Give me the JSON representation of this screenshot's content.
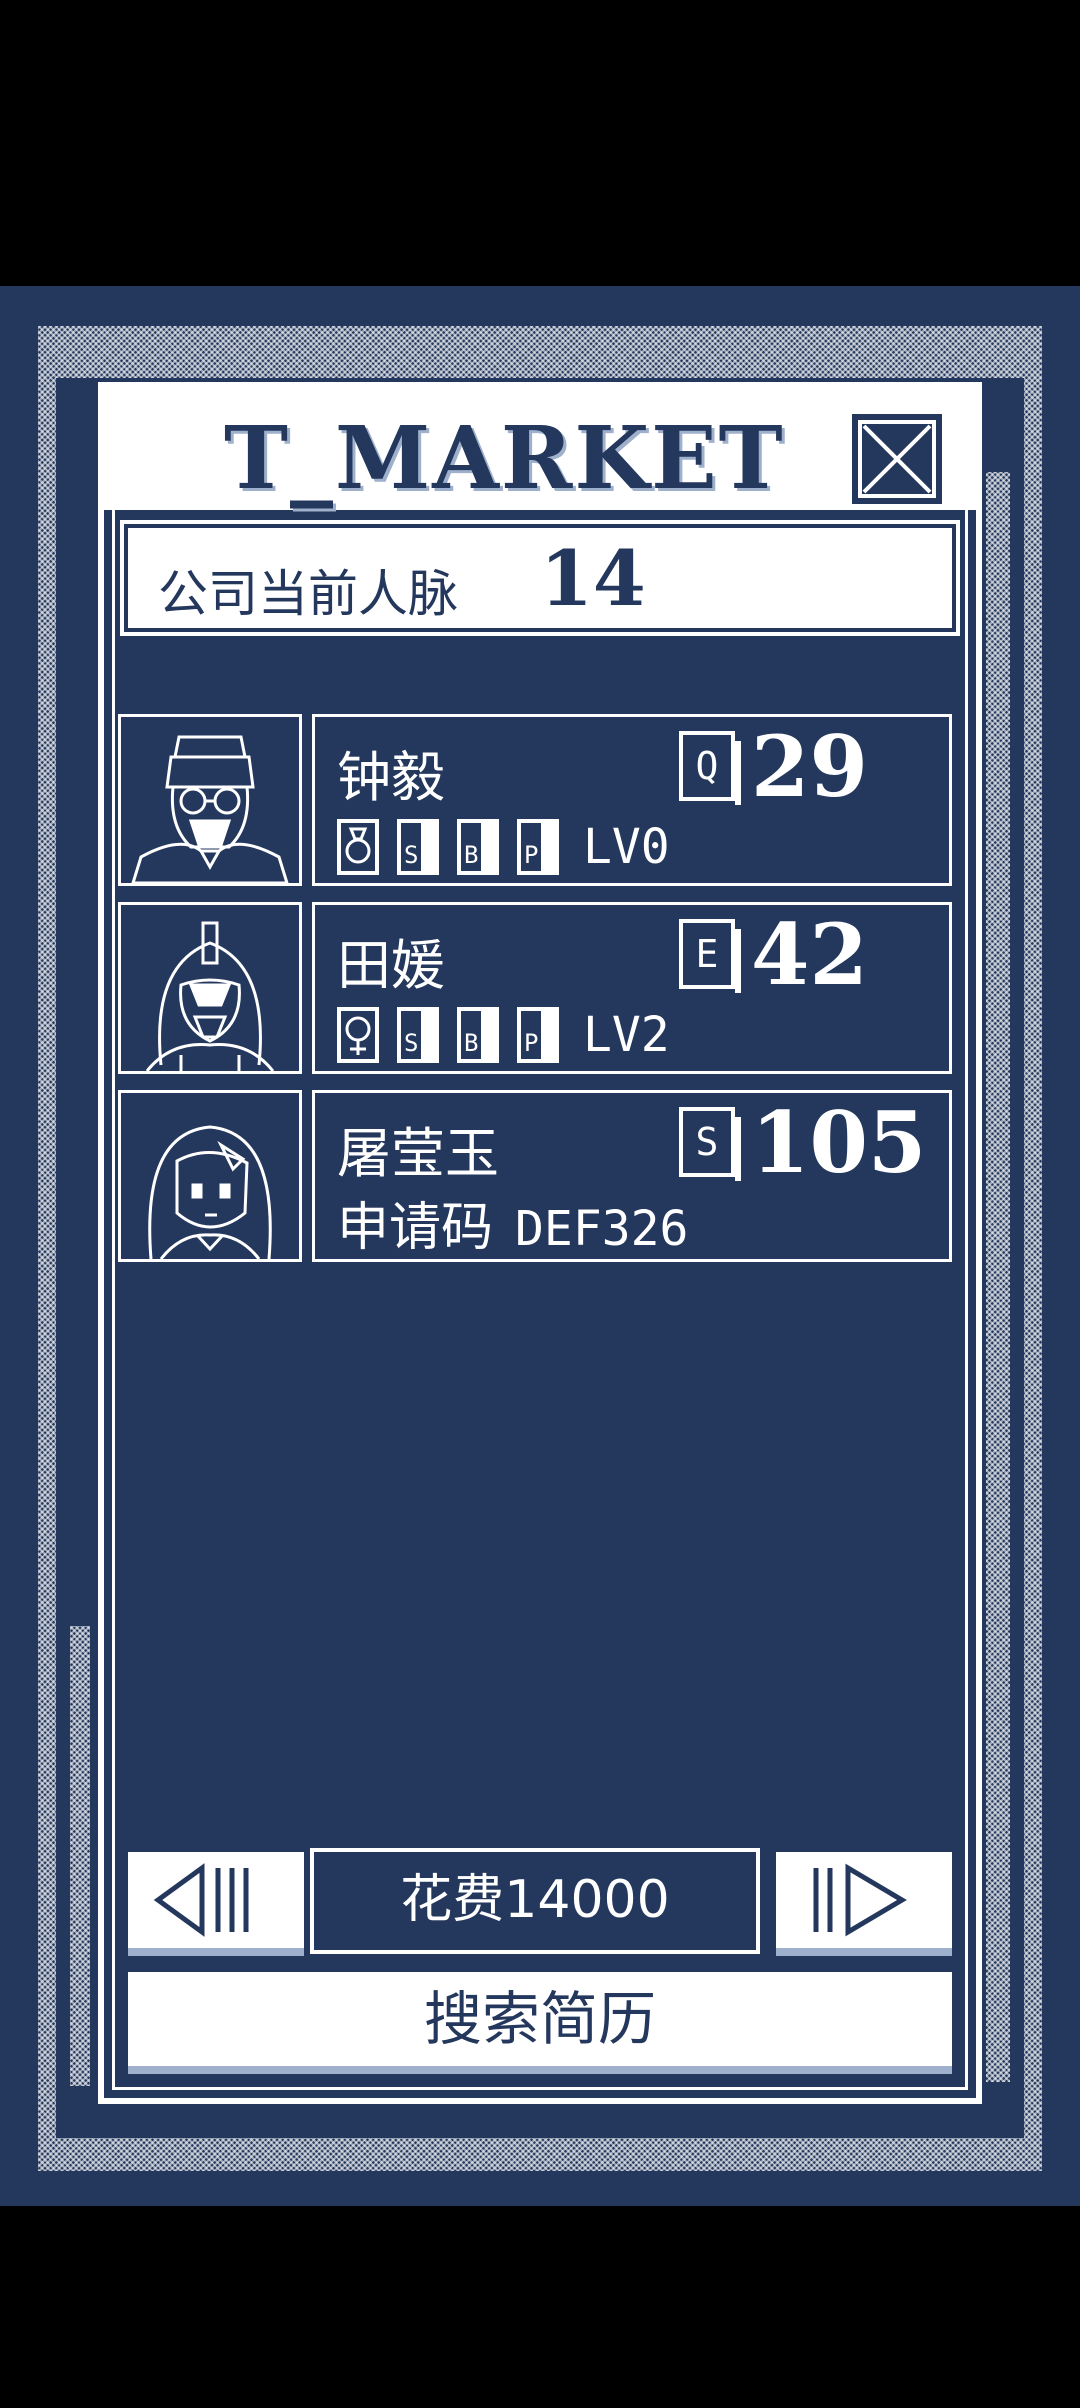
{
  "title": "T_MARKET",
  "network": {
    "label": "公司当前人脉",
    "value": "14"
  },
  "candidates": [
    {
      "name": "钟毅",
      "grade": "Q",
      "cost": "29",
      "skills": [
        "S",
        "B",
        "P"
      ],
      "level": "LV0"
    },
    {
      "name": "田媛",
      "grade": "E",
      "cost": "42",
      "skills": [
        "S",
        "B",
        "P"
      ],
      "level": "LV2"
    },
    {
      "name": "屠莹玉",
      "grade": "S",
      "cost": "105",
      "code_label": "申请码",
      "code_value": "DEF326"
    }
  ],
  "fee_label": "花费14000",
  "search_label": "搜索简历",
  "icons": {
    "close": "close-x-icon",
    "prev": "arrow-left-icon",
    "next": "arrow-right-icon",
    "gender_male": "male-icon",
    "gender_female": "female-icon"
  },
  "colors": {
    "navy": "#24375c",
    "white": "#ffffff",
    "shadow": "#9fb0cc"
  }
}
